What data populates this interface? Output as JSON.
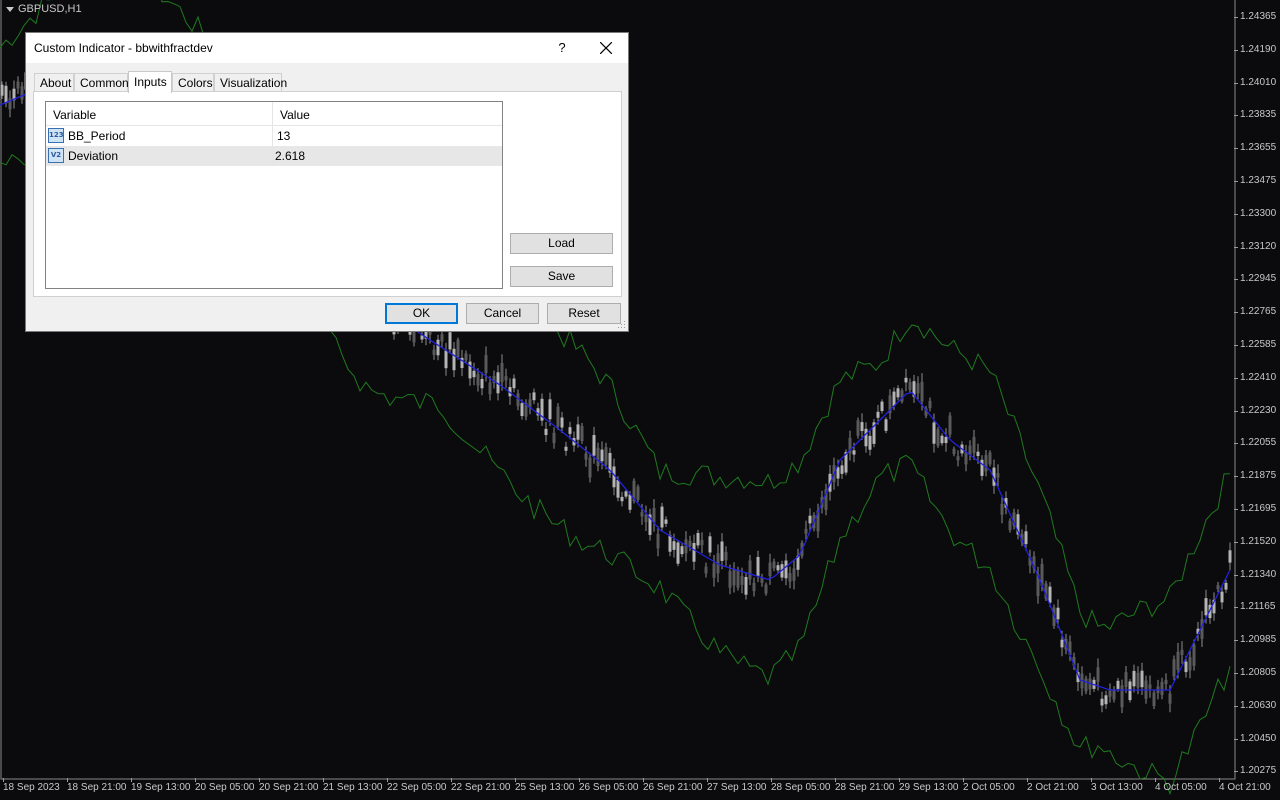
{
  "chart": {
    "symbol": "GBPUSD,H1",
    "price_ticks": [
      "1.24365",
      "1.24190",
      "1.24010",
      "1.23835",
      "1.23655",
      "1.23475",
      "1.23300",
      "1.23120",
      "1.22945",
      "1.22765",
      "1.22585",
      "1.22410",
      "1.22230",
      "1.22055",
      "1.21875",
      "1.21695",
      "1.21520",
      "1.21340",
      "1.21165",
      "1.20985",
      "1.20805",
      "1.20630",
      "1.20450",
      "1.20275"
    ],
    "time_ticks": [
      "18 Sep 2023",
      "18 Sep 21:00",
      "19 Sep 13:00",
      "20 Sep 05:00",
      "20 Sep 21:00",
      "21 Sep 13:00",
      "22 Sep 05:00",
      "22 Sep 21:00",
      "25 Sep 13:00",
      "26 Sep 05:00",
      "26 Sep 21:00",
      "27 Sep 13:00",
      "28 Sep 05:00",
      "28 Sep 21:00",
      "29 Sep 13:00",
      "2 Oct 05:00",
      "2 Oct 21:00",
      "3 Oct 13:00",
      "4 Oct 05:00",
      "4 Oct 21:00"
    ],
    "colors": {
      "background": "#0b0b0d",
      "candles": "#8c8c8c",
      "middle_band": "#2222dd",
      "outer_bands": "#1f7a1f"
    }
  },
  "dialog": {
    "title": "Custom Indicator - bbwithfractdev",
    "help_label": "?",
    "close_icon": "close-icon",
    "tabs": [
      {
        "label": "About"
      },
      {
        "label": "Common"
      },
      {
        "label": "Inputs"
      },
      {
        "label": "Colors"
      },
      {
        "label": "Visualization"
      }
    ],
    "active_tab": "Inputs",
    "grid": {
      "headers": {
        "variable": "Variable",
        "value": "Value"
      },
      "rows": [
        {
          "icon": "int-type-icon",
          "icon_text": "123",
          "variable": "BB_Period",
          "value": "13"
        },
        {
          "icon": "double-type-icon",
          "icon_text": "V2",
          "variable": "Deviation",
          "value": "2.618"
        }
      ]
    },
    "buttons": {
      "load": "Load",
      "save": "Save",
      "ok": "OK",
      "cancel": "Cancel",
      "reset": "Reset"
    }
  }
}
